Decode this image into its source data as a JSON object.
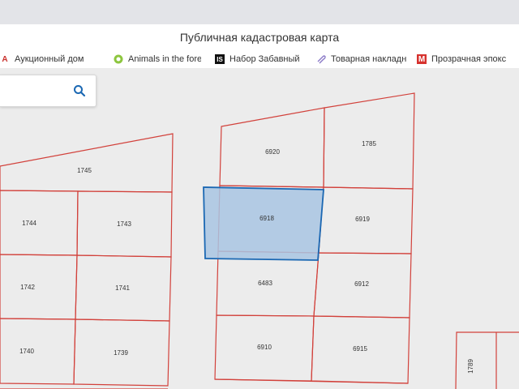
{
  "window": {
    "title": "Публичная кадастровая карта"
  },
  "bookmarks": [
    {
      "label": "Аукционный дом",
      "icon": "a-logo-icon"
    },
    {
      "label": "Animals in the fore",
      "icon": "circle-logo-icon"
    },
    {
      "label": "Набор Забавный",
      "icon": "is-logo-icon"
    },
    {
      "label": "Товарная накладн",
      "icon": "paperclip-icon"
    },
    {
      "label": "Прозрачная эпокс",
      "icon": "m-logo-icon"
    }
  ],
  "search": {
    "placeholder": "",
    "icon": "search-icon"
  },
  "map": {
    "selected_parcel": "6918",
    "parcels": [
      "1745",
      "1744",
      "1743",
      "1742",
      "1741",
      "1740",
      "1739",
      "6920",
      "1785",
      "6918",
      "6919",
      "6483",
      "6912",
      "6910",
      "6915",
      "1789"
    ],
    "colors": {
      "boundary": "#d2413b",
      "selection_fill": "#a9c6e3",
      "selection_stroke": "#1b68b3"
    }
  }
}
